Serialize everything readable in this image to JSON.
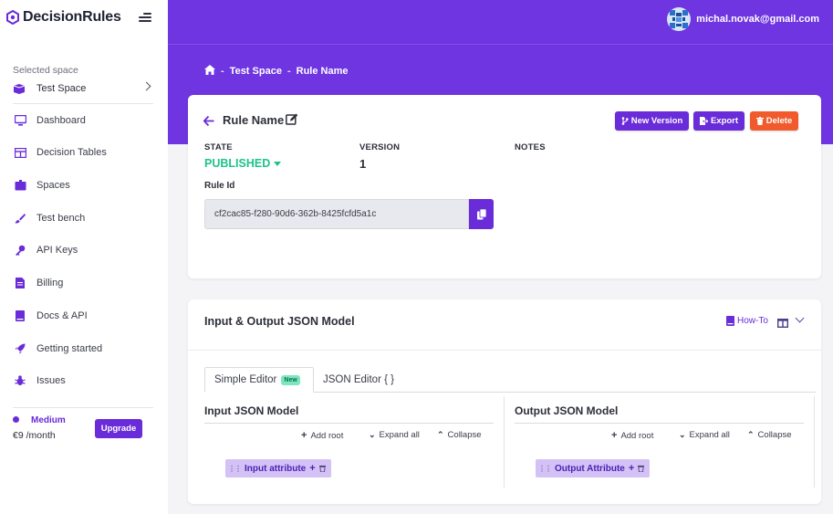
{
  "app": {
    "brand": "DecisionRules"
  },
  "sidebar": {
    "selected_space_label": "Selected space",
    "space_name": "Test Space",
    "items": [
      {
        "label": "Dashboard",
        "icon": "monitor-icon"
      },
      {
        "label": "Decision Tables",
        "icon": "table-icon"
      },
      {
        "label": "Spaces",
        "icon": "box-icon"
      },
      {
        "label": "Test bench",
        "icon": "brush-icon"
      },
      {
        "label": "API Keys",
        "icon": "key-icon"
      },
      {
        "label": "Billing",
        "icon": "invoice-icon"
      },
      {
        "label": "Docs & API",
        "icon": "book-icon"
      },
      {
        "label": "Getting started",
        "icon": "rocket-icon"
      },
      {
        "label": "Issues",
        "icon": "bug-icon"
      }
    ],
    "plan": {
      "name": "Medium",
      "price": "€9 /month",
      "upgrade_label": "Upgrade"
    }
  },
  "header": {
    "user_email": "michal.novak@gmail.com"
  },
  "breadcrumb": {
    "sep": "-",
    "space": "Test Space",
    "rule": "Rule Name"
  },
  "rule": {
    "title": "Rule Name",
    "buttons": {
      "new_version": "New Version",
      "export": "Export",
      "delete": "Delete"
    },
    "state_label": "STATE",
    "state_value": "PUBLISHED",
    "version_label": "VERSION",
    "version_value": "1",
    "notes_label": "NOTES",
    "rule_id_label": "Rule Id",
    "rule_id": "cf2cac85-f280-90d6-362b-8425fcfd5a1c"
  },
  "model": {
    "title": "Input & Output JSON Model",
    "howto_label": "How-To",
    "tabs": {
      "simple": "Simple Editor",
      "simple_badge": "New",
      "json": "JSON Editor { }"
    },
    "input": {
      "title": "Input JSON Model",
      "attribute": "Input attribute"
    },
    "output": {
      "title": "Output JSON Model",
      "attribute": "Output Attribute"
    },
    "actions": {
      "add_root": "Add root",
      "expand_all": "Expand all",
      "collapse": "Collapse"
    }
  },
  "colors": {
    "primary": "#6e35e0",
    "accent": "#6a2bd9",
    "success": "#1ec28b",
    "danger": "#f05a2c",
    "chip": "#d4c2f6"
  }
}
